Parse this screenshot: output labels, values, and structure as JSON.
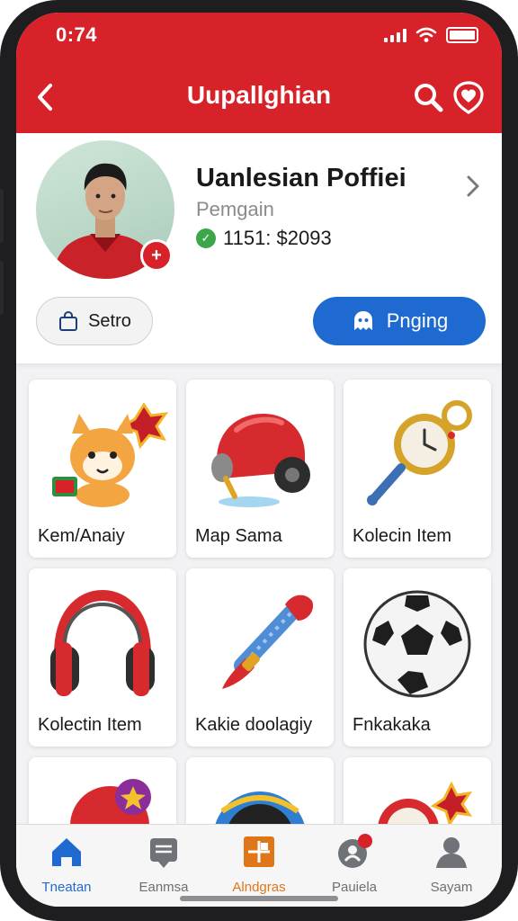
{
  "status_bar": {
    "time": "0:74"
  },
  "nav": {
    "title": "Uupallghian"
  },
  "profile": {
    "name": "Uanlesian Poffiei",
    "subtitle": "Pemgain",
    "stats": "1151: $2093",
    "badge": "+"
  },
  "actions": {
    "setro_label": "Setro",
    "pinging_label": "Pnging"
  },
  "grid_items": [
    {
      "label": "Kem/Anaiy",
      "icon": "fox-mascot-icon"
    },
    {
      "label": "Map Sama",
      "icon": "red-bell-device-icon"
    },
    {
      "label": "Kolecin Item",
      "icon": "pocket-watch-key-icon"
    },
    {
      "label": "Kolectin Item",
      "icon": "headphones-icon"
    },
    {
      "label": "Kakie doolagiy",
      "icon": "torch-icon"
    },
    {
      "label": "Fnkakaka",
      "icon": "soccer-ball-icon"
    },
    {
      "label": "",
      "icon": "star-badge-icon"
    },
    {
      "label": "",
      "icon": "blue-orb-icon"
    },
    {
      "label": "",
      "icon": "red-clock-icon"
    }
  ],
  "tabs": [
    {
      "label": "Tneatan",
      "icon": "home-icon",
      "active": true
    },
    {
      "label": "Eanmsa",
      "icon": "chat-icon"
    },
    {
      "label": "Alndgras",
      "icon": "app-grid-icon"
    },
    {
      "label": "Pauiela",
      "icon": "profile-badge-icon",
      "notification": "×"
    },
    {
      "label": "Sayam",
      "icon": "person-icon"
    }
  ],
  "colors": {
    "header": "#d8222a",
    "primary_button": "#1f6ad0",
    "active_tab": "#1f6ad0",
    "accent_tab": "#e0761a"
  }
}
